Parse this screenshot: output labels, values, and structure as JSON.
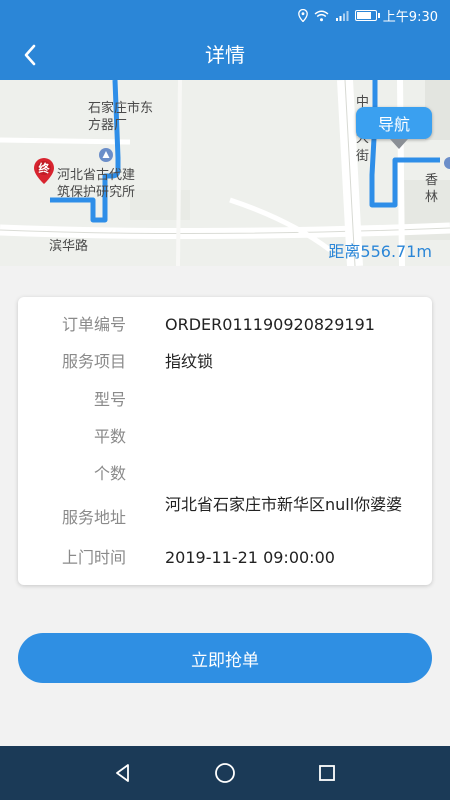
{
  "status_bar": {
    "time": "上午9:30"
  },
  "header": {
    "title": "详情",
    "back_icon": "chevron-left-icon"
  },
  "map": {
    "nav_button_label": "导航",
    "distance_label": "距离556.71m",
    "end_marker_label": "终",
    "labels": {
      "factory": "石家庄市东\n方器厂",
      "institute": "河北省古代建\n筑保护研究所",
      "road": "滨华路",
      "street": "中\n北\n大\n街",
      "partial": "香林"
    }
  },
  "order": {
    "rows": [
      {
        "label": "订单编号",
        "value": "ORDER011190920829191"
      },
      {
        "label": "服务项目",
        "value": "指纹锁"
      },
      {
        "label": "型号",
        "value": ""
      },
      {
        "label": "平数",
        "value": ""
      },
      {
        "label": "个数",
        "value": ""
      },
      {
        "label": "服务地址",
        "value": "河北省石家庄市新华区null你婆婆"
      },
      {
        "label": "上门时间",
        "value": "2019-11-21 09:00:00"
      }
    ]
  },
  "actions": {
    "grab_order_label": "立即抢单"
  },
  "colors": {
    "primary": "#2b86d7",
    "button": "#2f8fe3",
    "route": "#2e8ee8",
    "system_nav": "#1b3a57"
  }
}
